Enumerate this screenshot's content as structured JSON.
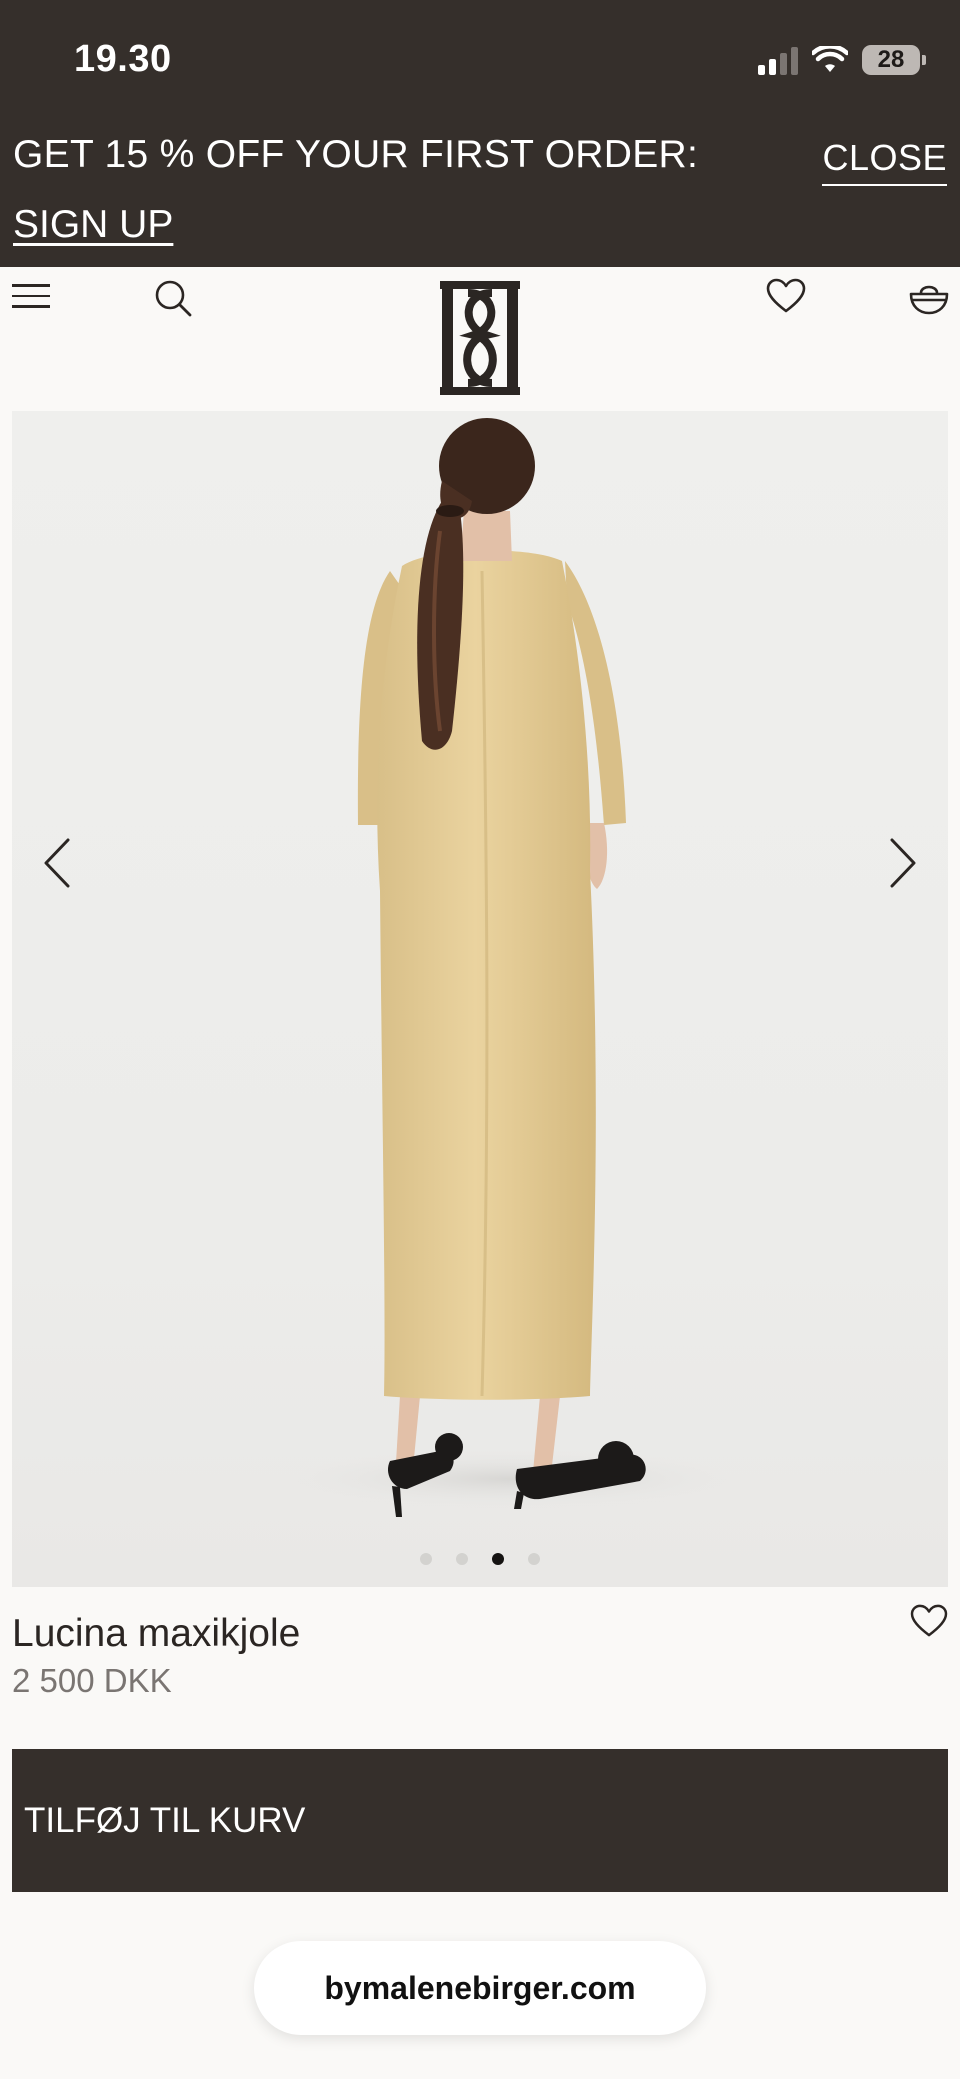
{
  "status_bar": {
    "time": "19.30",
    "battery": "28"
  },
  "promo": {
    "text": "GET 15 % OFF YOUR FIRST ORDER:",
    "signup_label": "SIGN UP",
    "close_label": "CLOSE"
  },
  "header": {
    "icons": [
      "menu-icon",
      "search-icon",
      "logo",
      "heart-icon",
      "basket-icon"
    ]
  },
  "gallery": {
    "slide_count": 4,
    "active_index": 2
  },
  "product": {
    "name": "Lucina maxikjole",
    "price": "2 500 DKK"
  },
  "cart": {
    "add_label": "TILFØJ TIL KURV"
  },
  "browser": {
    "url": "bymalenebirger.com"
  },
  "colors": {
    "dark": "#352f2b",
    "background": "#faf9f7",
    "dress": "#e3cc96"
  }
}
